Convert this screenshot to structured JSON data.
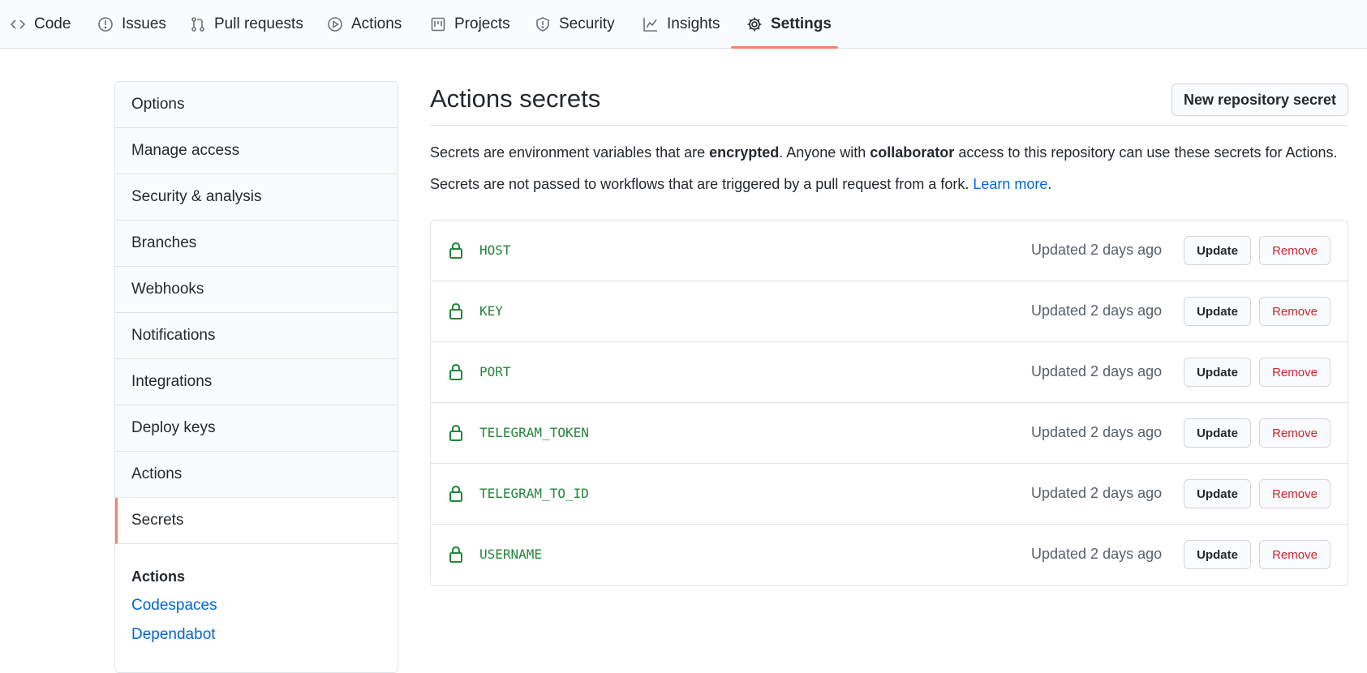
{
  "nav": {
    "tabs": [
      {
        "label": "Code",
        "icon": "code-icon"
      },
      {
        "label": "Issues",
        "icon": "issue-opened-icon"
      },
      {
        "label": "Pull requests",
        "icon": "git-pull-request-icon"
      },
      {
        "label": "Actions",
        "icon": "play-icon"
      },
      {
        "label": "Projects",
        "icon": "project-icon"
      },
      {
        "label": "Security",
        "icon": "shield-icon"
      },
      {
        "label": "Insights",
        "icon": "graph-icon"
      },
      {
        "label": "Settings",
        "icon": "gear-icon",
        "selected": true
      }
    ],
    "accent": "#f9826c"
  },
  "sidebar": {
    "items": [
      {
        "label": "Options"
      },
      {
        "label": "Manage access"
      },
      {
        "label": "Security & analysis"
      },
      {
        "label": "Branches"
      },
      {
        "label": "Webhooks"
      },
      {
        "label": "Notifications"
      },
      {
        "label": "Integrations"
      },
      {
        "label": "Deploy keys"
      },
      {
        "label": "Actions"
      },
      {
        "label": "Secrets",
        "selected": true
      }
    ],
    "subsection": {
      "heading": "Actions",
      "links": [
        "Codespaces",
        "Dependabot"
      ]
    }
  },
  "main": {
    "title": "Actions secrets",
    "new_button": "New repository secret",
    "desc1": {
      "part1": "Secrets are environment variables that are ",
      "bold1": "encrypted",
      "part2": ". Anyone with ",
      "bold2": "collaborator",
      "part3": " access to this repository can use these secrets for Actions."
    },
    "desc2": {
      "text": "Secrets are not passed to workflows that are triggered by a pull request from a fork. ",
      "link": "Learn more",
      "end": "."
    },
    "secrets": [
      {
        "name": "HOST",
        "updated": "Updated 2 days ago",
        "update_label": "Update",
        "remove_label": "Remove"
      },
      {
        "name": "KEY",
        "updated": "Updated 2 days ago",
        "update_label": "Update",
        "remove_label": "Remove"
      },
      {
        "name": "PORT",
        "updated": "Updated 2 days ago",
        "update_label": "Update",
        "remove_label": "Remove"
      },
      {
        "name": "TELEGRAM_TOKEN",
        "updated": "Updated 2 days ago",
        "update_label": "Update",
        "remove_label": "Remove"
      },
      {
        "name": "TELEGRAM_TO_ID",
        "updated": "Updated 2 days ago",
        "update_label": "Update",
        "remove_label": "Remove"
      },
      {
        "name": "USERNAME",
        "updated": "Updated 2 days ago",
        "update_label": "Update",
        "remove_label": "Remove"
      }
    ],
    "secret_icon": "lock-icon",
    "colors": {
      "secret_name": "#22863a",
      "remove": "#cb2431",
      "link": "#0366d6"
    }
  }
}
